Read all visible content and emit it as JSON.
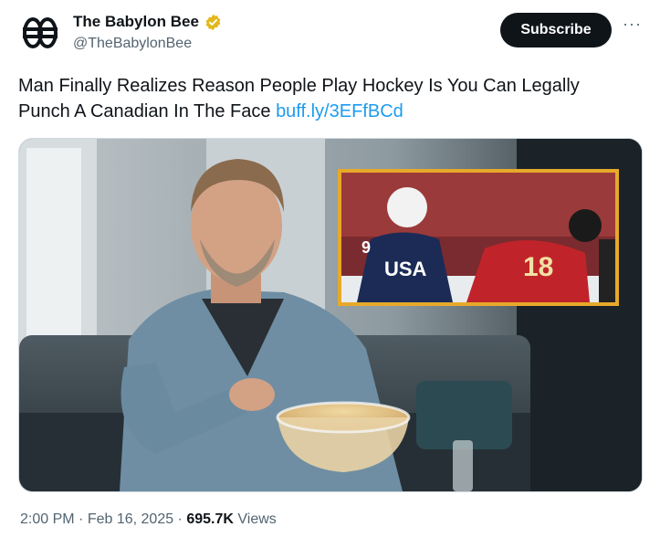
{
  "account": {
    "display_name": "The Babylon Bee",
    "handle": "@TheBabylonBee",
    "verified": true,
    "avatar_icon": "babylon-bee-logo-icon",
    "verified_icon": "gold-verified-badge-icon"
  },
  "actions": {
    "subscribe_label": "Subscribe",
    "more_label": "···"
  },
  "post": {
    "text": "Man Finally Realizes Reason People Play Hockey Is You Can Legally Punch A Canadian In The Face",
    "link": "buff.ly/3EFfBCd"
  },
  "media": {
    "inset_jersey_text": "USA",
    "inset_number_blue": "9",
    "inset_number_red": "18"
  },
  "meta": {
    "time": "2:00 PM",
    "separator": " · ",
    "date": "Feb 16, 2025",
    "views_count": "695.7K",
    "views_label": "Views"
  },
  "colors": {
    "text": "#0f1419",
    "secondary": "#536471",
    "link": "#1d9bf0",
    "verified_gold": "#e2b719",
    "inset_border": "#e7a92a"
  }
}
